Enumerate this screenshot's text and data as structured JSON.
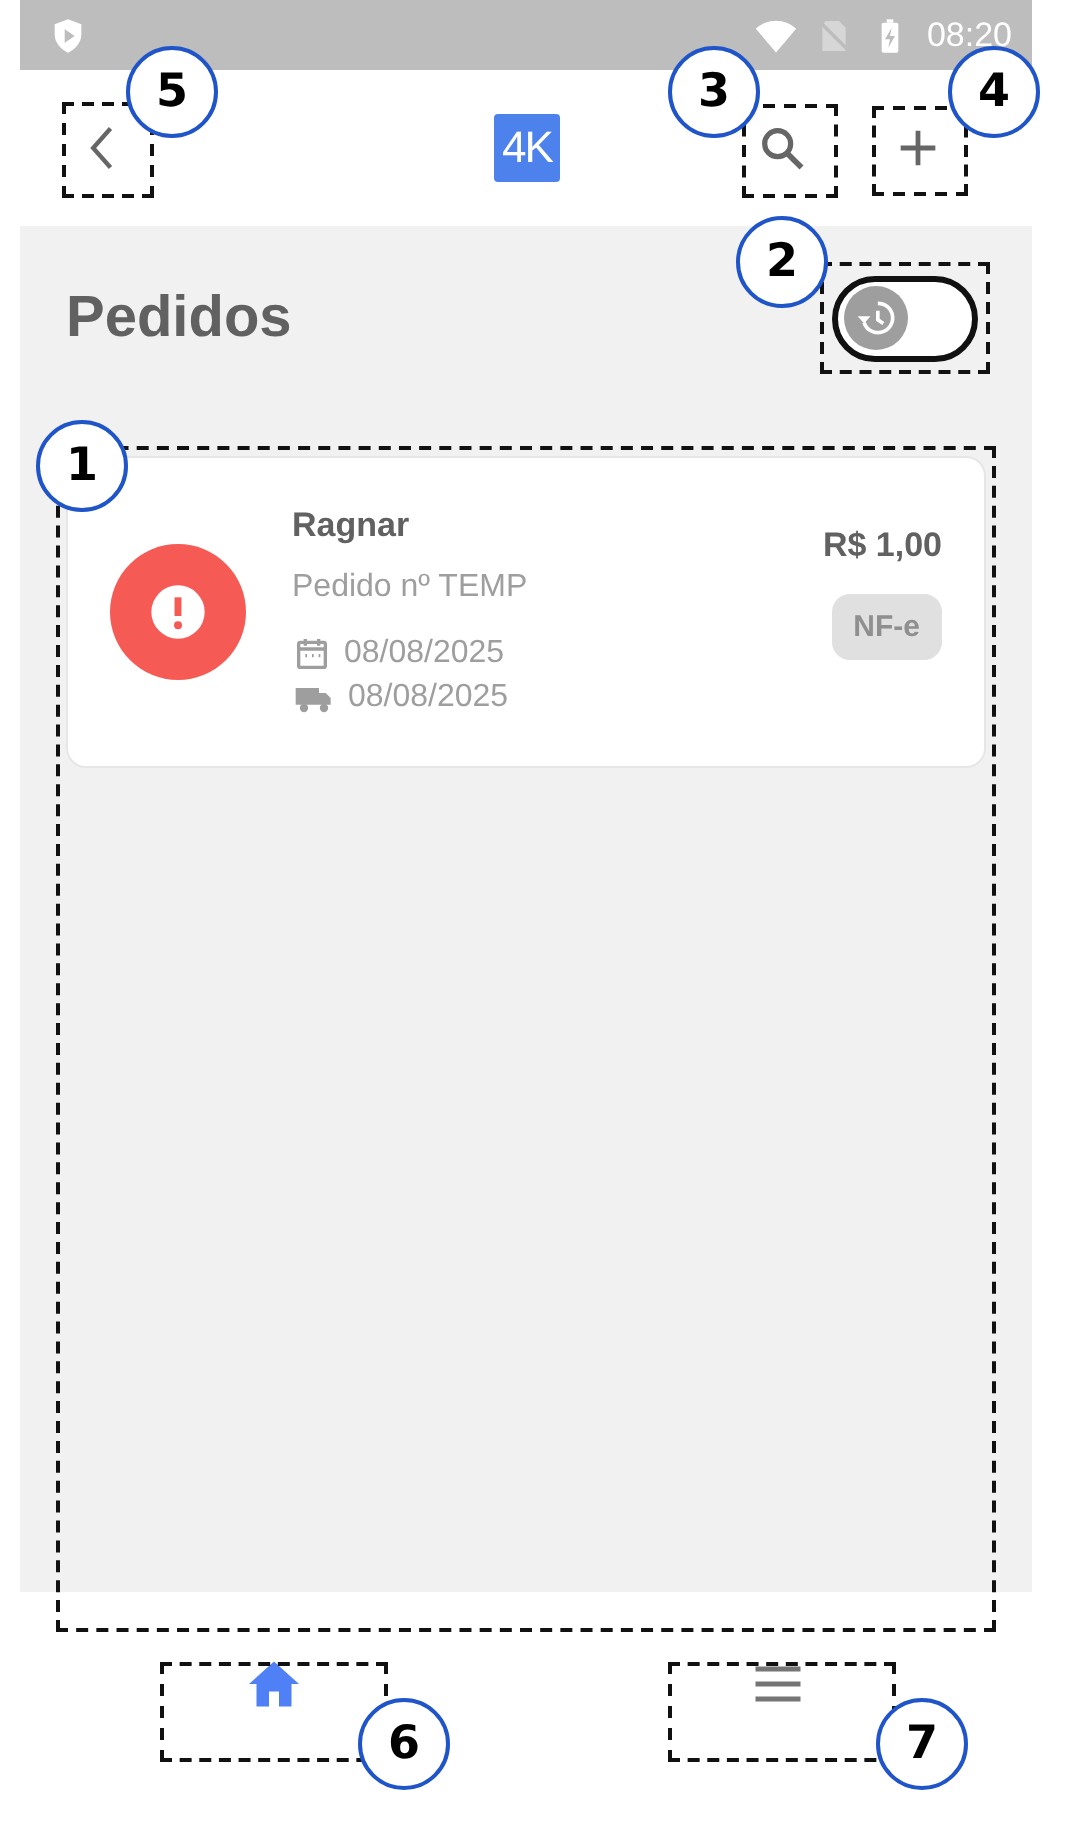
{
  "status_bar": {
    "time": "08:20"
  },
  "header": {
    "logo": "4K"
  },
  "title": "Pedidos",
  "history_toggle": {
    "on": false
  },
  "orders": [
    {
      "customer": "Ragnar",
      "order_number": "Pedido nº TEMP",
      "created_date": "08/08/2025",
      "delivery_date": "08/08/2025",
      "price": "R$ 1,00",
      "badge": "NF-e",
      "kind": "error"
    }
  ],
  "bottom_nav": [
    {
      "kind": "home",
      "selected": true
    },
    {
      "kind": "menu",
      "selected": false
    }
  ],
  "annotations": [
    {
      "label": "5"
    },
    {
      "label": "3"
    },
    {
      "label": "4"
    },
    {
      "label": "2"
    },
    {
      "label": "1"
    },
    {
      "label": "6"
    },
    {
      "label": "7"
    }
  ]
}
